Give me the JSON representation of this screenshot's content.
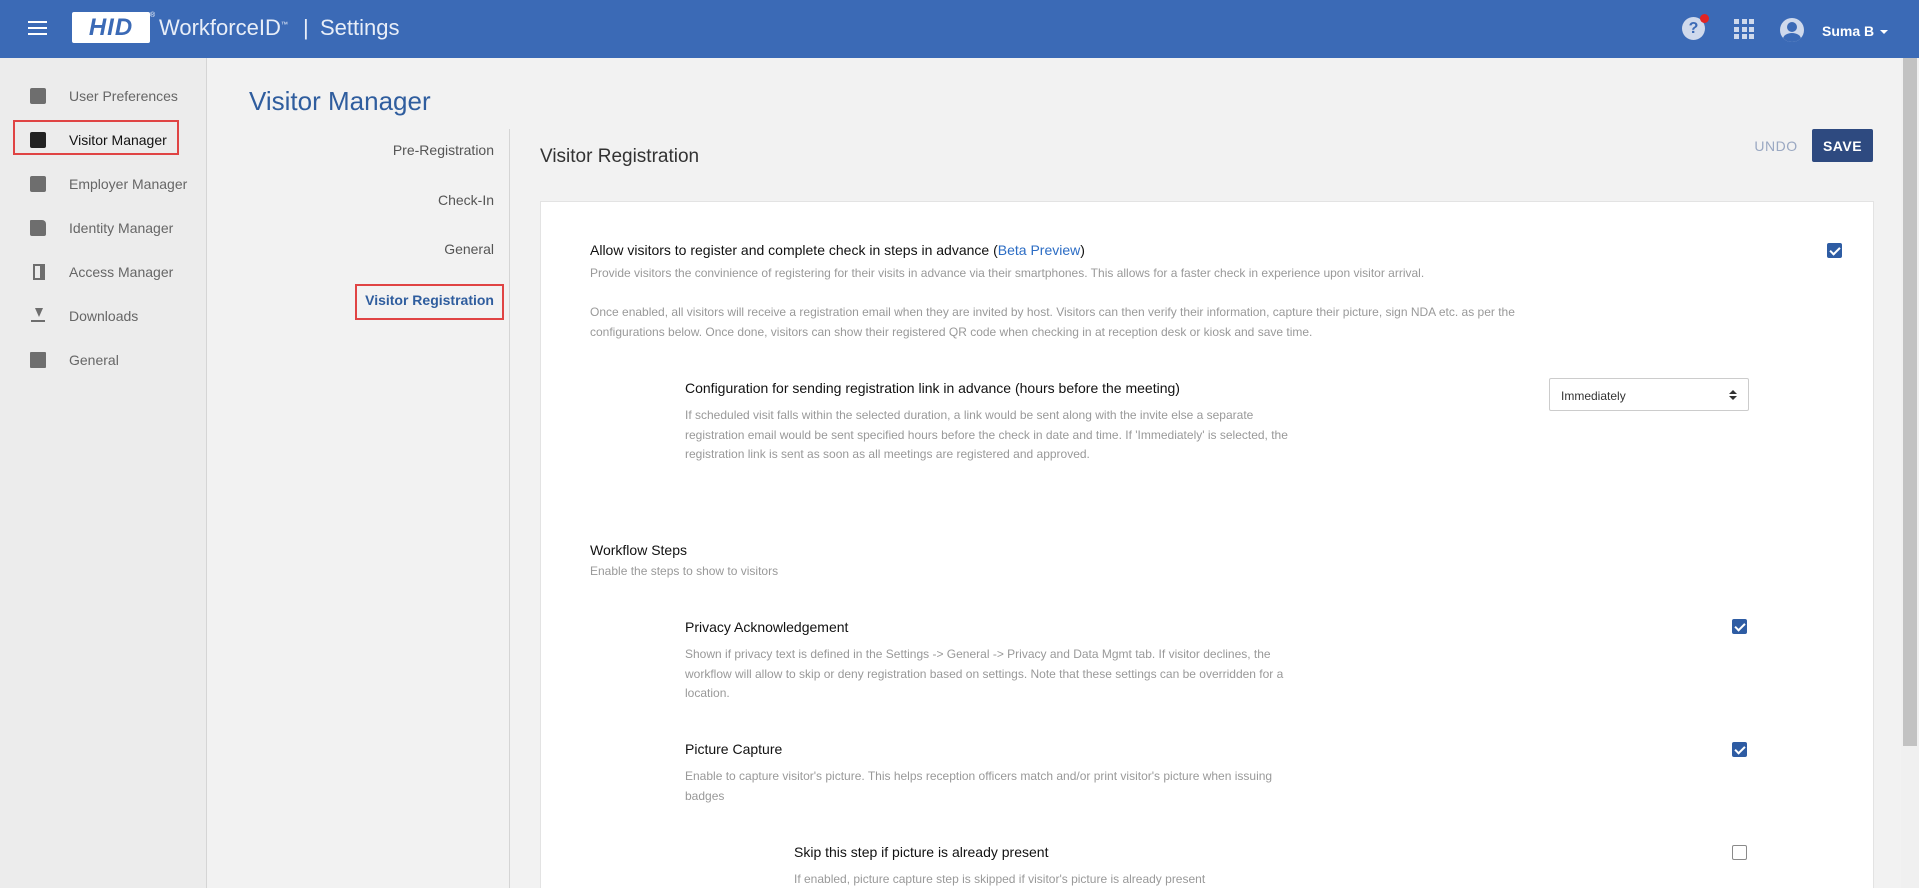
{
  "header": {
    "logo": "HID",
    "logo_tm": "®",
    "app_name": "WorkforceID",
    "app_tm": "™",
    "separator": "|",
    "section": "Settings",
    "help_glyph": "?",
    "user": "Suma B",
    "icons": [
      "hamburger-icon",
      "help-icon",
      "apps-grid-icon",
      "user-avatar-icon",
      "caret-down-icon"
    ],
    "notification_color": "#e02424"
  },
  "sidebar": {
    "items": [
      {
        "label": "User Preferences",
        "icon": "user-icon"
      },
      {
        "label": "Visitor Manager",
        "icon": "visitor-badge-icon"
      },
      {
        "label": "Employer Manager",
        "icon": "employee-badge-icon"
      },
      {
        "label": "Identity Manager",
        "icon": "identity-folder-icon"
      },
      {
        "label": "Access Manager",
        "icon": "door-icon"
      },
      {
        "label": "Downloads",
        "icon": "download-icon"
      },
      {
        "label": "General",
        "icon": "list-icon"
      }
    ],
    "active": "Visitor Manager"
  },
  "page": {
    "title": "Visitor Manager",
    "subnav": [
      "Pre-Registration",
      "Check-In",
      "General",
      "Visitor Registration"
    ],
    "subnav_active": "Visitor Registration"
  },
  "section": {
    "title": "Visitor Registration",
    "undo_label": "UNDO",
    "save_label": "SAVE"
  },
  "settings": {
    "allow": {
      "title_prefix": "Allow visitors to register and complete check in steps in advance (",
      "title_link": "Beta Preview",
      "title_suffix": ")",
      "desc1": "Provide visitors the convinience of registering for their visits in advance via their smartphones. This allows for a faster check in experience upon visitor arrival.",
      "desc2": "Once enabled, all visitors will receive a registration email when they are invited by host. Visitors can then verify their information, capture their picture, sign NDA etc. as per the configurations below. Once done, visitors can show their registered QR code when checking in at reception desk or kiosk and save time.",
      "checked": true
    },
    "config": {
      "title": "Configuration for sending registration link in advance (hours before the meeting)",
      "desc": "If scheduled visit falls within the selected duration, a link would be sent along with the invite else a separate registration email would be sent specified hours before the check in date and time. If 'Immediately' is selected, the registration link is sent as soon as all meetings are registered and approved.",
      "value": "Immediately"
    },
    "workflow": {
      "title": "Workflow Steps",
      "desc": "Enable the steps to show to visitors"
    },
    "privacy": {
      "title": "Privacy Acknowledgement",
      "desc": "Shown if privacy text is defined in the Settings -> General -> Privacy and Data Mgmt tab. If visitor declines, the workflow will allow to skip or deny registration based on settings. Note that these settings can be overridden for a location.",
      "checked": true
    },
    "picture": {
      "title": "Picture Capture",
      "desc": "Enable to capture visitor's picture. This helps reception officers match and/or print visitor's picture when issuing badges",
      "checked": true
    },
    "skip": {
      "title": "Skip this step if picture is already present",
      "desc": "If enabled, picture capture step is skipped if visitor's picture is already present",
      "checked": false
    }
  },
  "colors": {
    "topbar": "#3b6ab6",
    "accent": "#2f5d9e",
    "save_button": "#2e4a80",
    "checkbox": "#2e5ca3",
    "highlight": "#e04444"
  }
}
